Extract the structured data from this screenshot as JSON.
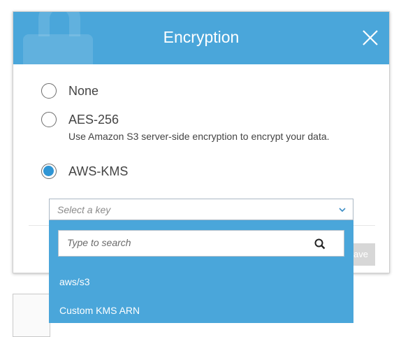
{
  "modal": {
    "title": "Encryption",
    "close_icon": "close-icon",
    "watermark_icon": "lock-icon"
  },
  "options": [
    {
      "label": "None",
      "selected": false
    },
    {
      "label": "AES-256",
      "selected": false,
      "description": "Use Amazon S3 server-side encryption to encrypt your data."
    },
    {
      "label": "AWS-KMS",
      "selected": true
    }
  ],
  "key_select": {
    "placeholder": "Select a key",
    "icon": "chevron-down-icon"
  },
  "dropdown": {
    "search_placeholder": "Type to search",
    "search_icon": "search-icon",
    "items": [
      "aws/s3",
      "Custom KMS ARN"
    ]
  },
  "footer": {
    "save_label": "ave"
  },
  "colors": {
    "header": "#4aa6da",
    "radio_selected": "#2f95d4",
    "dropdown_bg": "#4aa6da",
    "save_disabled": "#d7d7d7"
  }
}
